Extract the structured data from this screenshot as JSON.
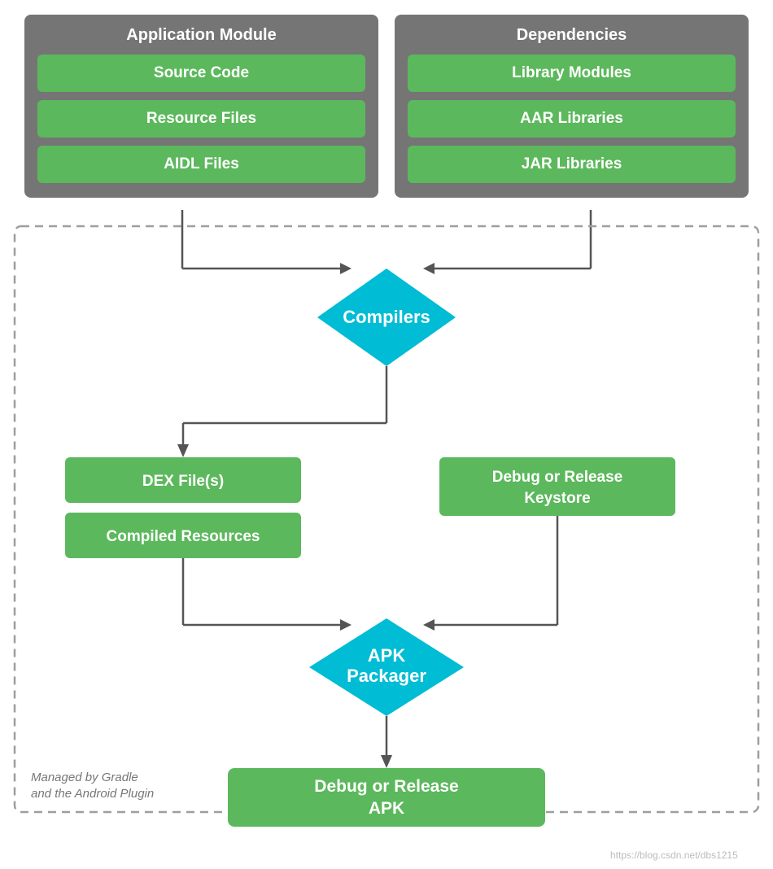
{
  "app_module": {
    "title": "Application Module",
    "items": [
      "Source Code",
      "Resource Files",
      "AIDL Files"
    ]
  },
  "dependencies": {
    "title": "Dependencies",
    "items": [
      "Library Modules",
      "AAR Libraries",
      "JAR Libraries"
    ]
  },
  "flow": {
    "compilers": "Compilers",
    "dex_files": "DEX File(s)",
    "compiled_resources": "Compiled Resources",
    "debug_keystore": "Debug or Release\nKeystore",
    "apk_packager": "APK\nPackager",
    "final_apk": "Debug or Release\nAPK",
    "gradle_label": "Managed by Gradle\nand the Android Plugin"
  },
  "watermark": "https://blog.csdn.net/dbs1215"
}
